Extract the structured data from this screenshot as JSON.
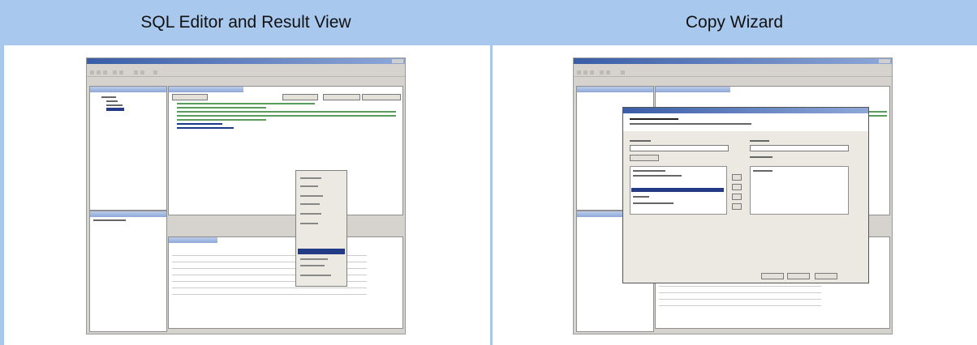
{
  "headers": {
    "left": "SQL Editor and Result View",
    "right": "Copy Wizard"
  }
}
